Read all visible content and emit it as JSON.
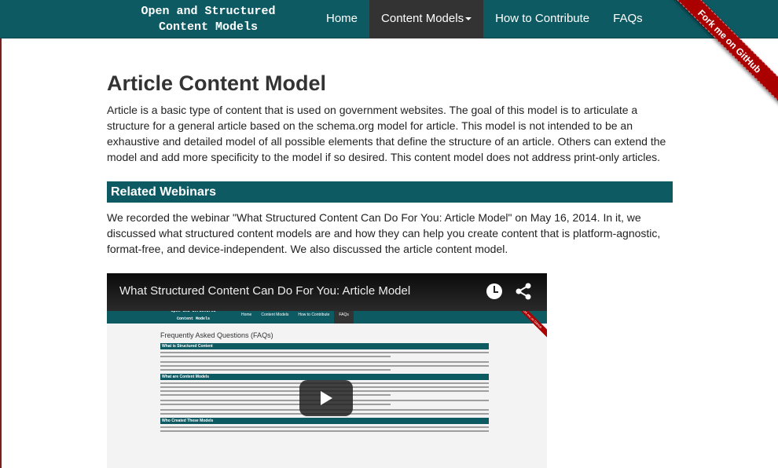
{
  "header": {
    "brand": "Open and Structured\nContent Models",
    "nav": [
      {
        "label": "Home"
      },
      {
        "label": "Content Models"
      },
      {
        "label": "How to Contribute"
      },
      {
        "label": "FAQs"
      }
    ],
    "ribbon": "Fork me on GitHub"
  },
  "main": {
    "title": "Article Content Model",
    "intro": "Article is a basic type of content that is used on government websites. The goal of this model is to articulate a structure for a general article based on the schema.org model for article. This model is not intended to be an exhaustive and detailed model of all possible elements that define the structure of an article. Others can extend the model and add more specificity to the model if so desired. This content model does not address print-only articles.",
    "webinars": {
      "heading": "Related Webinars",
      "text": "We recorded the webinar \"What Structured Content Can Do For You: Article Model\" on May 16, 2014. In it, we discussed what structured content models are and how they can help you create content that is platform-agnostic, format-free, and device-independent. We also discussed the article content model."
    }
  },
  "video": {
    "title": "What Structured Content Can Do For You: Article Model",
    "thumb": {
      "brand": "Open and Structured\nContent Models",
      "nav": [
        "Home",
        "Content Models",
        "How to Contribute",
        "FAQs"
      ],
      "ribbon": "Fork me on GitHub",
      "heading": "Frequently Asked Questions (FAQs)",
      "sections": [
        "What is Structured Content",
        "What are Content Models",
        "Who Created These Models"
      ]
    }
  }
}
